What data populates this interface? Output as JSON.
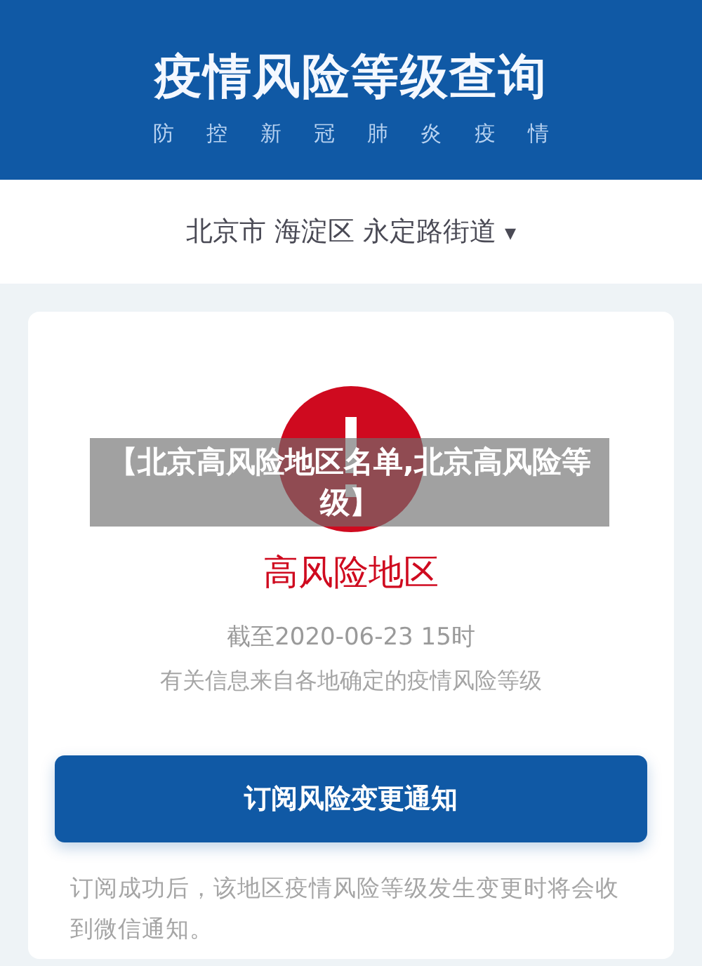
{
  "header": {
    "title": "疫情风险等级查询",
    "subtitle": [
      "防",
      "控",
      "新",
      "冠",
      "肺",
      "炎",
      "疫",
      "情"
    ]
  },
  "location": {
    "value": "北京市 海淀区 永定路街道",
    "caret": "▾"
  },
  "result": {
    "kind": "high",
    "label": "高风险地区",
    "as_of": "截至2020-06-23 15时",
    "source": "有关信息来自各地确定的疫情风险等级"
  },
  "subscribe_button": "订阅风险变更通知",
  "note": "订阅成功后，该地区疫情风险等级发生变更时将会收到微信通知。",
  "overlay_caption": "【北京高风险地区名单,北京高风险等级】"
}
